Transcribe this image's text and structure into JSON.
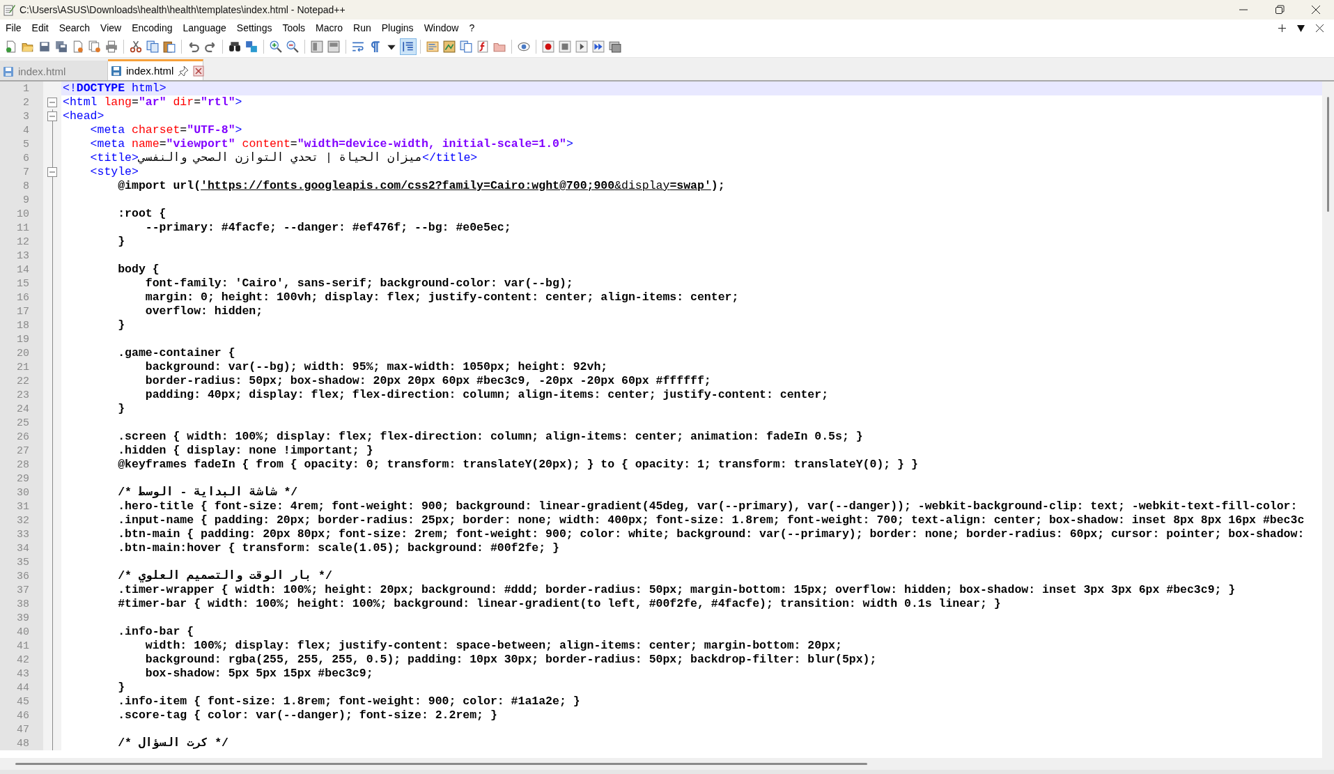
{
  "window": {
    "title": "C:\\Users\\ASUS\\Downloads\\health\\health\\templates\\index.html - Notepad++"
  },
  "menu": [
    "File",
    "Edit",
    "Search",
    "View",
    "Encoding",
    "Language",
    "Settings",
    "Tools",
    "Macro",
    "Run",
    "Plugins",
    "Window",
    "?"
  ],
  "toolbar": {
    "indent_guide": {
      "on": true
    }
  },
  "tabs": [
    {
      "label": "index.html",
      "selected": false
    },
    {
      "label": "index.html",
      "selected": true
    }
  ],
  "lines": [
    {
      "number": "1",
      "current": true,
      "fold": false,
      "tokens": [
        {
          "kind": "tag",
          "text": "<!"
        },
        {
          "kind": "doctype",
          "text": "DOCTYPE"
        },
        {
          "kind": "tag",
          "text": " html>"
        }
      ]
    },
    {
      "number": "2",
      "current": false,
      "fold": true,
      "tokens": [
        {
          "kind": "tag",
          "text": "<html"
        },
        {
          "kind": "attr",
          "text": " lang"
        },
        {
          "kind": "eq",
          "text": "="
        },
        {
          "kind": "value",
          "text": "\"ar\""
        },
        {
          "kind": "attr",
          "text": " dir"
        },
        {
          "kind": "eq",
          "text": "="
        },
        {
          "kind": "value",
          "text": "\"rtl\""
        },
        {
          "kind": "tag",
          "text": ">"
        }
      ]
    },
    {
      "number": "3",
      "current": false,
      "fold": true,
      "tokens": [
        {
          "kind": "tag",
          "text": "<head>"
        }
      ]
    },
    {
      "number": "4",
      "current": false,
      "fold": false,
      "tokens": [
        {
          "kind": "tag",
          "text": "    <meta"
        },
        {
          "kind": "attr",
          "text": " charset"
        },
        {
          "kind": "eq",
          "text": "="
        },
        {
          "kind": "value",
          "text": "\"UTF-8\""
        },
        {
          "kind": "tag",
          "text": ">"
        }
      ]
    },
    {
      "number": "5",
      "current": false,
      "fold": false,
      "tokens": [
        {
          "kind": "tag",
          "text": "    <meta"
        },
        {
          "kind": "attr",
          "text": " name"
        },
        {
          "kind": "eq",
          "text": "="
        },
        {
          "kind": "value",
          "text": "\"viewport\""
        },
        {
          "kind": "attr",
          "text": " content"
        },
        {
          "kind": "eq",
          "text": "="
        },
        {
          "kind": "value",
          "text": "\"width=device-width, initial-scale=1.0\""
        },
        {
          "kind": "tag",
          "text": ">"
        }
      ]
    },
    {
      "number": "6",
      "current": false,
      "fold": false,
      "tokens": [
        {
          "kind": "tag",
          "text": "    <title>"
        },
        {
          "kind": "text",
          "text": "ميزان الحياة | تحدي التوازن الصحي والنفسي"
        },
        {
          "kind": "tag",
          "text": "</title>"
        }
      ]
    },
    {
      "number": "7",
      "current": false,
      "fold": true,
      "tokens": [
        {
          "kind": "tag",
          "text": "    <style>"
        }
      ]
    },
    {
      "number": "8",
      "current": false,
      "fold": false,
      "tokens": [
        {
          "kind": "css",
          "text": "        @import url("
        },
        {
          "kind": "url",
          "text": "'https://fonts.googleapis.com/css2?family=Cairo:wght@700;900"
        },
        {
          "kind": "url-plain",
          "text": "&display"
        },
        {
          "kind": "url",
          "text": "=swap'"
        },
        {
          "kind": "css",
          "text": ");"
        }
      ]
    },
    {
      "number": "9",
      "current": false,
      "fold": false
    },
    {
      "number": "10",
      "current": false,
      "fold": false,
      "tokens": [
        {
          "kind": "css",
          "text": "        :root {"
        }
      ]
    },
    {
      "number": "11",
      "current": false,
      "fold": false,
      "tokens": [
        {
          "kind": "css",
          "text": "            --primary: #4facfe; --danger: #ef476f; --bg: #e0e5ec;"
        }
      ]
    },
    {
      "number": "12",
      "current": false,
      "fold": false,
      "tokens": [
        {
          "kind": "css",
          "text": "        }"
        }
      ]
    },
    {
      "number": "13",
      "current": false,
      "fold": false
    },
    {
      "number": "14",
      "current": false,
      "fold": false,
      "tokens": [
        {
          "kind": "css",
          "text": "        body {"
        }
      ]
    },
    {
      "number": "15",
      "current": false,
      "fold": false,
      "tokens": [
        {
          "kind": "css",
          "text": "            font-family: 'Cairo', sans-serif; background-color: var(--bg);"
        }
      ]
    },
    {
      "number": "16",
      "current": false,
      "fold": false,
      "tokens": [
        {
          "kind": "css",
          "text": "            margin: 0; height: 100vh; display: flex; justify-content: center; align-items: center;"
        }
      ]
    },
    {
      "number": "17",
      "current": false,
      "fold": false,
      "tokens": [
        {
          "kind": "css",
          "text": "            overflow: hidden;"
        }
      ]
    },
    {
      "number": "18",
      "current": false,
      "fold": false,
      "tokens": [
        {
          "kind": "css",
          "text": "        }"
        }
      ]
    },
    {
      "number": "19",
      "current": false,
      "fold": false
    },
    {
      "number": "20",
      "current": false,
      "fold": false,
      "tokens": [
        {
          "kind": "css",
          "text": "        .game-container {"
        }
      ]
    },
    {
      "number": "21",
      "current": false,
      "fold": false,
      "tokens": [
        {
          "kind": "css",
          "text": "            background: var(--bg); width: 95%; max-width: 1050px; height: 92vh;"
        }
      ]
    },
    {
      "number": "22",
      "current": false,
      "fold": false,
      "tokens": [
        {
          "kind": "css",
          "text": "            border-radius: 50px; box-shadow: 20px 20px 60px #bec3c9, -20px -20px 60px #ffffff;"
        }
      ]
    },
    {
      "number": "23",
      "current": false,
      "fold": false,
      "tokens": [
        {
          "kind": "css",
          "text": "            padding: 40px; display: flex; flex-direction: column; align-items: center; justify-content: center;"
        }
      ]
    },
    {
      "number": "24",
      "current": false,
      "fold": false,
      "tokens": [
        {
          "kind": "css",
          "text": "        }"
        }
      ]
    },
    {
      "number": "25",
      "current": false,
      "fold": false
    },
    {
      "number": "26",
      "current": false,
      "fold": false,
      "tokens": [
        {
          "kind": "css",
          "text": "        .screen { width: 100%; display: flex; flex-direction: column; align-items: center; animation: fadeIn 0.5s; }"
        }
      ]
    },
    {
      "number": "27",
      "current": false,
      "fold": false,
      "tokens": [
        {
          "kind": "css",
          "text": "        .hidden { display: none !important; }"
        }
      ]
    },
    {
      "number": "28",
      "current": false,
      "fold": false,
      "tokens": [
        {
          "kind": "css",
          "text": "        @keyframes fadeIn { from { opacity: 0; transform: translateY(20px); } to { opacity: 1; transform: translateY(0); } }"
        }
      ]
    },
    {
      "number": "29",
      "current": false,
      "fold": false
    },
    {
      "number": "30",
      "current": false,
      "fold": false,
      "tokens": [
        {
          "kind": "css",
          "text": "        /* شاشة البداية - الوسط */"
        }
      ]
    },
    {
      "number": "31",
      "current": false,
      "fold": false,
      "tokens": [
        {
          "kind": "css",
          "text": "        .hero-title { font-size: 4rem; font-weight: 900; background: linear-gradient(45deg, var(--primary), var(--danger)); -webkit-background-clip: text; -webkit-text-fill-color:"
        }
      ]
    },
    {
      "number": "32",
      "current": false,
      "fold": false,
      "tokens": [
        {
          "kind": "css",
          "text": "        .input-name { padding: 20px; border-radius: 25px; border: none; width: 400px; font-size: 1.8rem; font-weight: 700; text-align: center; box-shadow: inset 8px 8px 16px #bec3c"
        }
      ]
    },
    {
      "number": "33",
      "current": false,
      "fold": false,
      "tokens": [
        {
          "kind": "css",
          "text": "        .btn-main { padding: 20px 80px; font-size: 2rem; font-weight: 900; color: white; background: var(--primary); border: none; border-radius: 60px; cursor: pointer; box-shadow:"
        }
      ]
    },
    {
      "number": "34",
      "current": false,
      "fold": false,
      "tokens": [
        {
          "kind": "css",
          "text": "        .btn-main:hover { transform: scale(1.05); background: #00f2fe; }"
        }
      ]
    },
    {
      "number": "35",
      "current": false,
      "fold": false
    },
    {
      "number": "36",
      "current": false,
      "fold": false,
      "tokens": [
        {
          "kind": "css",
          "text": "        /* بار الوقت والتصميم العلوي */"
        }
      ]
    },
    {
      "number": "37",
      "current": false,
      "fold": false,
      "tokens": [
        {
          "kind": "css",
          "text": "        .timer-wrapper { width: 100%; height: 20px; background: #ddd; border-radius: 50px; margin-bottom: 15px; overflow: hidden; box-shadow: inset 3px 3px 6px #bec3c9; }"
        }
      ]
    },
    {
      "number": "38",
      "current": false,
      "fold": false,
      "tokens": [
        {
          "kind": "css",
          "text": "        #timer-bar { width: 100%; height: 100%; background: linear-gradient(to left, #00f2fe, #4facfe); transition: width 0.1s linear; }"
        }
      ]
    },
    {
      "number": "39",
      "current": false,
      "fold": false
    },
    {
      "number": "40",
      "current": false,
      "fold": false,
      "tokens": [
        {
          "kind": "css",
          "text": "        .info-bar {"
        }
      ]
    },
    {
      "number": "41",
      "current": false,
      "fold": false,
      "tokens": [
        {
          "kind": "css",
          "text": "            width: 100%; display: flex; justify-content: space-between; align-items: center; margin-bottom: 20px;"
        }
      ]
    },
    {
      "number": "42",
      "current": false,
      "fold": false,
      "tokens": [
        {
          "kind": "css",
          "text": "            background: rgba(255, 255, 255, 0.5); padding: 10px 30px; border-radius: 50px; backdrop-filter: blur(5px);"
        }
      ]
    },
    {
      "number": "43",
      "current": false,
      "fold": false,
      "tokens": [
        {
          "kind": "css",
          "text": "            box-shadow: 5px 5px 15px #bec3c9;"
        }
      ]
    },
    {
      "number": "44",
      "current": false,
      "fold": false,
      "tokens": [
        {
          "kind": "css",
          "text": "        }"
        }
      ]
    },
    {
      "number": "45",
      "current": false,
      "fold": false,
      "tokens": [
        {
          "kind": "css",
          "text": "        .info-item { font-size: 1.8rem; font-weight: 900; color: #1a1a2e; }"
        }
      ]
    },
    {
      "number": "46",
      "current": false,
      "fold": false,
      "tokens": [
        {
          "kind": "css",
          "text": "        .score-tag { color: var(--danger); font-size: 2.2rem; }"
        }
      ]
    },
    {
      "number": "47",
      "current": false,
      "fold": false
    },
    {
      "number": "48",
      "current": false,
      "fold": false,
      "tokens": [
        {
          "kind": "css",
          "text": "        /* كرت السؤال */"
        }
      ]
    }
  ]
}
